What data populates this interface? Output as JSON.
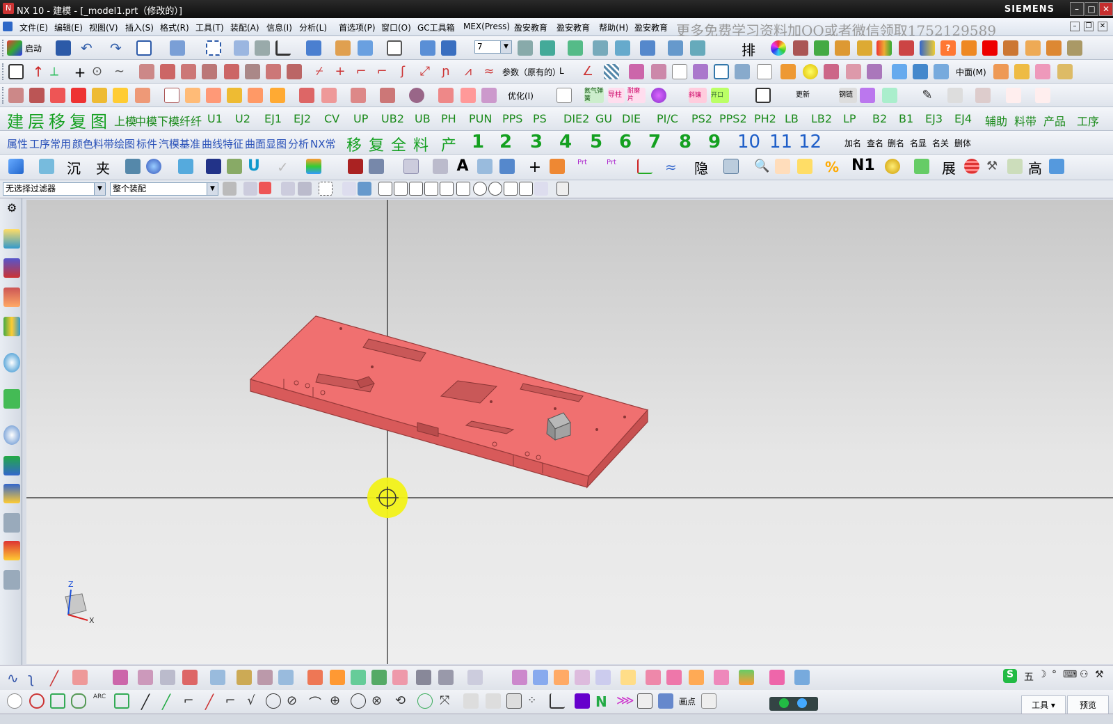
{
  "window": {
    "app_icon": "nx-logo-icon",
    "title": "NX 10 - 建模 - [_model1.prt（修改的）]",
    "brand": "SIEMENS",
    "controls": [
      "minimize-icon",
      "maximize-icon",
      "close-icon"
    ],
    "restore": [
      "minimize-icon",
      "restore-icon",
      "close-icon"
    ]
  },
  "menu": {
    "items": [
      "文件(E)",
      "编辑(E)",
      "视图(V)",
      "插入(S)",
      "格式(R)",
      "工具(T)",
      "装配(A)",
      "信息(I)",
      "分析(L)",
      "首选项(P)",
      "窗口(O)",
      "GC工具箱",
      "MEX(Press)",
      "盈安教育",
      "盈安教育",
      "帮助(H)",
      "盈安教育"
    ],
    "watermark": "更多免费学习资料加QQ或者微信领取1752129589"
  },
  "toolbar1": {
    "start_label": "启动",
    "layer_value": "7",
    "pai_label": "排"
  },
  "toolbar2": {
    "params_label": "参数（原有的）",
    "params_suffix": "L",
    "face_label": "中面(M)"
  },
  "toolbar3": {
    "optimize_label": "优化(I)",
    "button_labels": [
      "氮气弹簧",
      "导柱",
      "耐磨片",
      "斜镶",
      "开口",
      "更新",
      "钢链"
    ]
  },
  "toolbar4": {
    "cn_labels": [
      "建",
      "层",
      "移",
      "复",
      "图"
    ],
    "items": [
      "上模",
      "中模",
      "下模",
      "纤纤",
      "U1",
      "U2",
      "EJ1",
      "EJ2",
      "CV",
      "UP",
      "UB2",
      "UB",
      "PH",
      "PUN",
      "PPS",
      "PS",
      "DIE2",
      "GU",
      "DIE",
      "PI/C",
      "PS2",
      "PPS2",
      "PH2",
      "LB",
      "LB2",
      "LP",
      "B2",
      "B1",
      "EJ3",
      "EJ4",
      "辅助",
      "料带",
      "产品",
      "工序"
    ]
  },
  "toolbar5": {
    "items": [
      "属性",
      "工序",
      "常用",
      "颜色",
      "料带",
      "绘图",
      "标件",
      "汽模",
      "基准",
      "曲线",
      "特征",
      "曲面",
      "显图",
      "分析",
      "NX常"
    ],
    "big_cn": [
      "移",
      "复",
      "全",
      "料",
      "产"
    ],
    "numbers": [
      "1",
      "2",
      "3",
      "4",
      "5",
      "6",
      "7",
      "8",
      "9",
      "10",
      "11",
      "12"
    ],
    "right": [
      "加名",
      "查名",
      "删名",
      "名显",
      "名关",
      "删体"
    ]
  },
  "toolbar6": {
    "labels": [
      "沉",
      "夹",
      "隐",
      "N1",
      "展",
      "高"
    ]
  },
  "filter": {
    "selection_filter": "无选择过滤器",
    "scope": "整个装配"
  },
  "viewport": {
    "triad_z": "Z",
    "triad_x": "X",
    "model_color": "#f07070"
  },
  "bottom": {
    "arc_label": "ARC",
    "point_label": "画点"
  },
  "ime": {
    "text": "五"
  },
  "tabs": {
    "tools": "工具",
    "preview": "预览"
  }
}
